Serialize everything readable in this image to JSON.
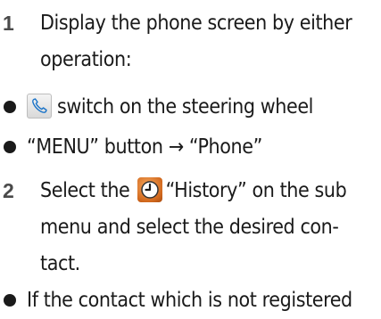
{
  "steps": [
    {
      "number": "1",
      "lines": [
        "Display the phone screen by either",
        "operation:"
      ]
    },
    {
      "number": "2",
      "line1_before": "Select the",
      "line1_after": "“History” on the sub",
      "lines": [
        "menu and select the desired con-",
        "tact."
      ]
    }
  ],
  "bullets": {
    "phone_switch": "switch on the steering wheel",
    "menu_phone": "“MENU” button → “Phone”",
    "not_registered": "If the contact which is not registered"
  },
  "icons": {
    "phone": "phone-handset-icon",
    "history": "clock-icon"
  }
}
